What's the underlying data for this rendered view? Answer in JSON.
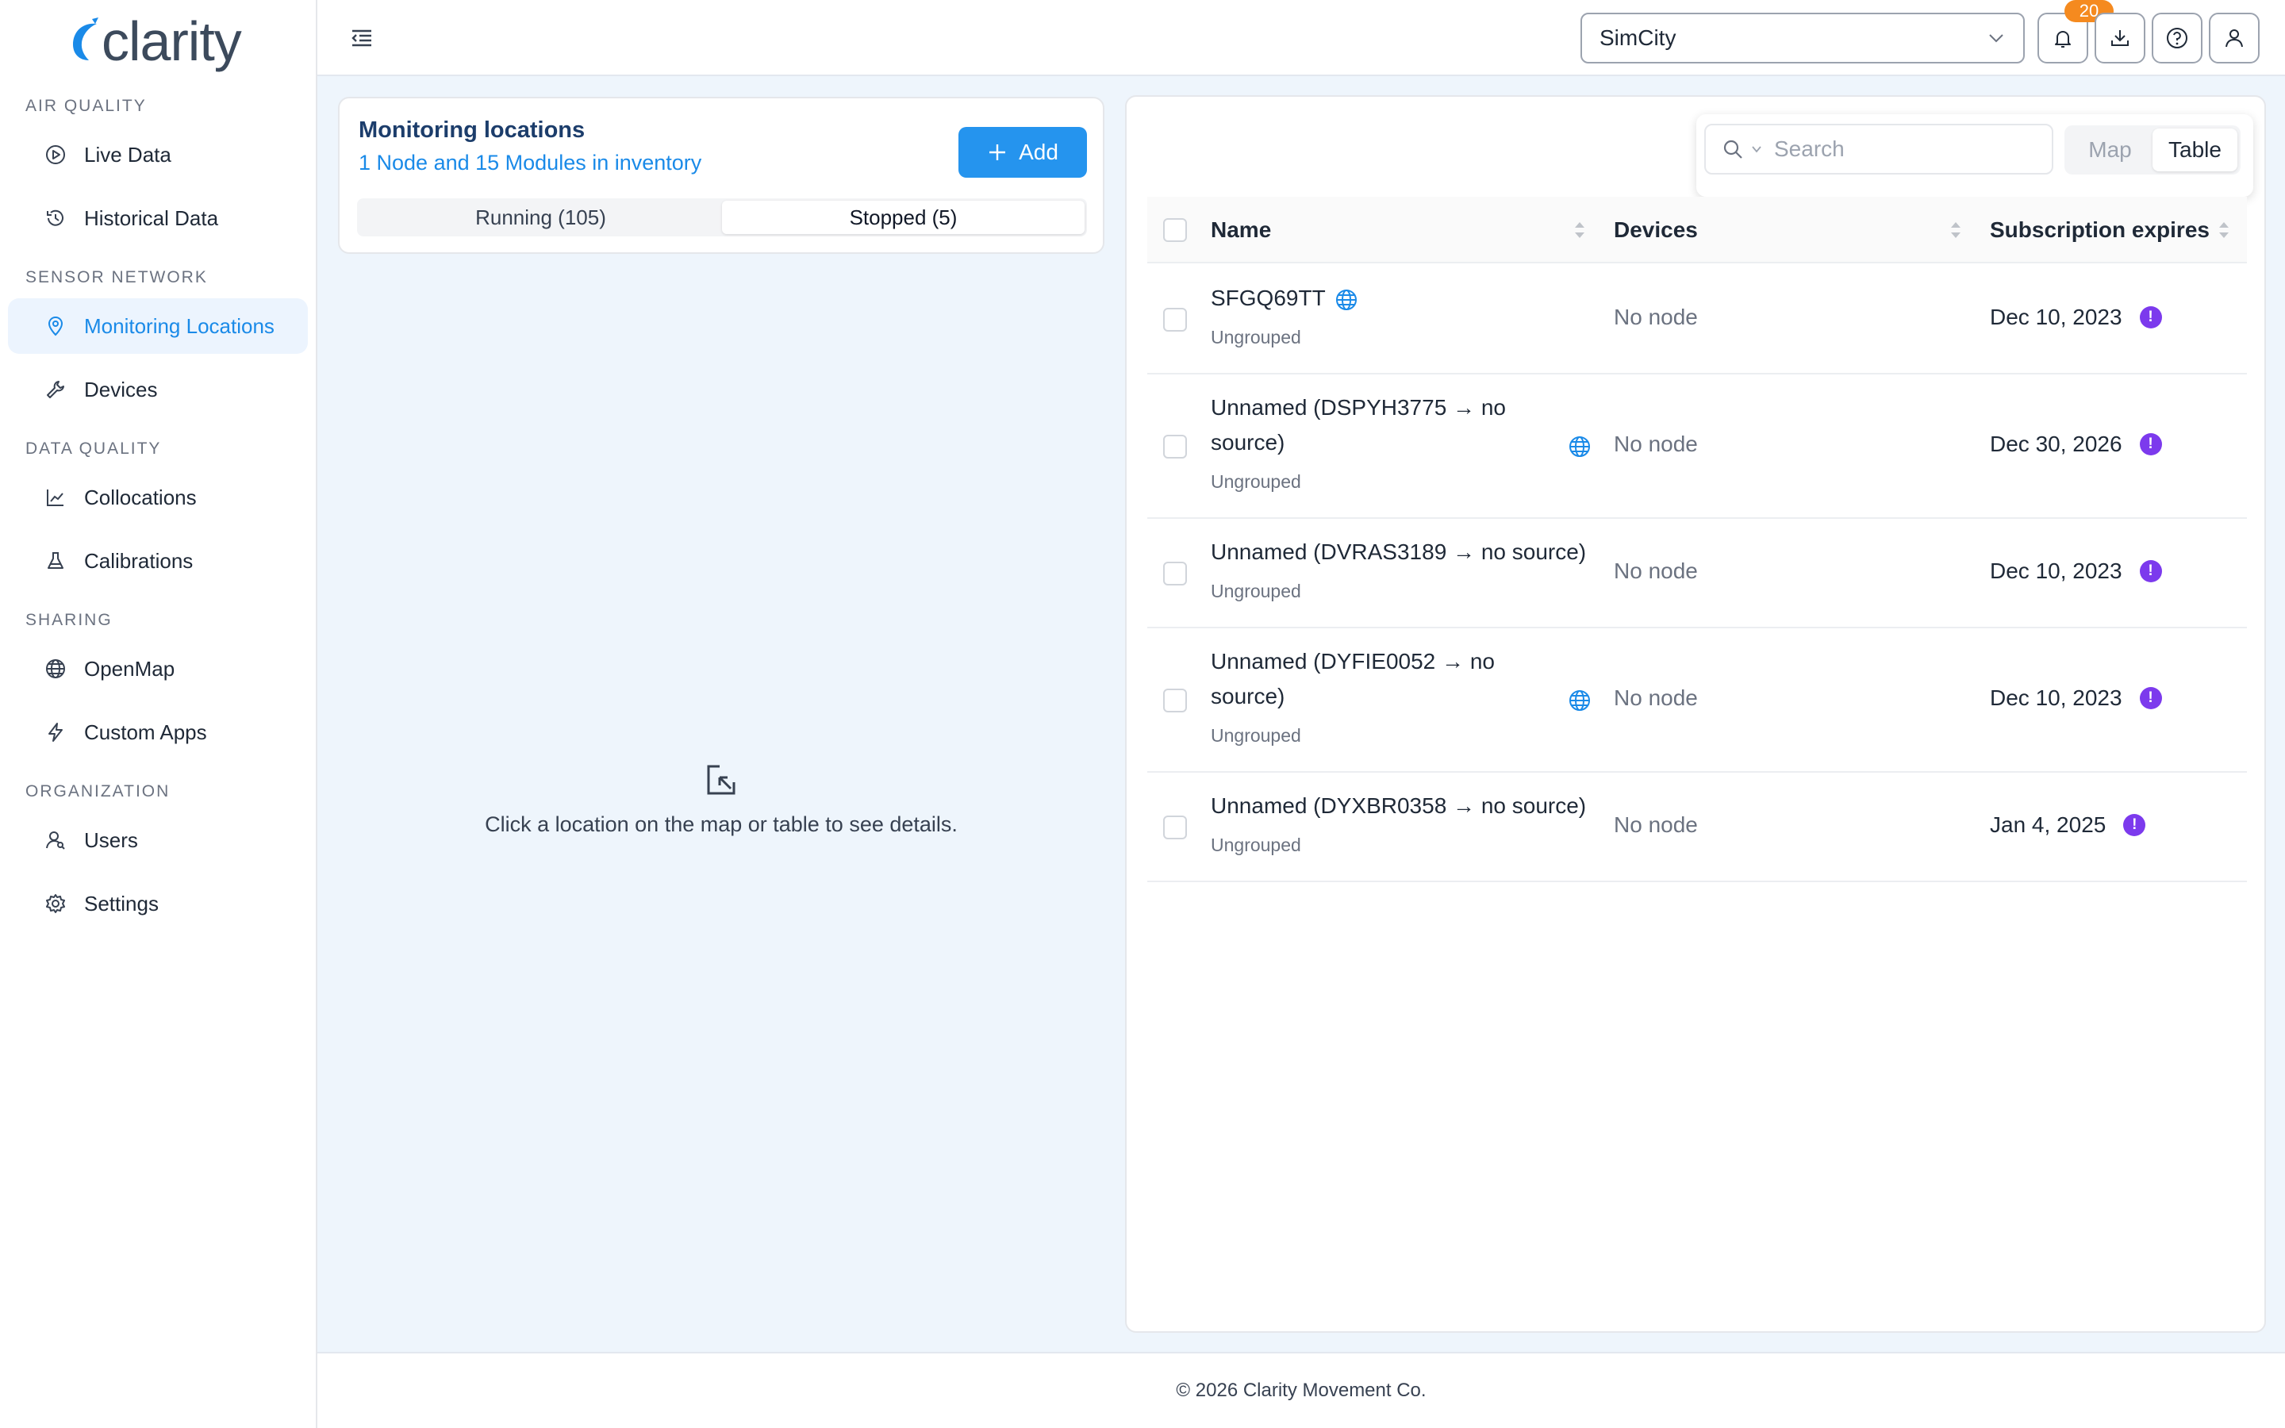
{
  "app": {
    "logo_text": "clarity"
  },
  "sidebar": {
    "sections": [
      {
        "title": "AIR QUALITY",
        "items": [
          {
            "label": "Live Data"
          },
          {
            "label": "Historical Data"
          }
        ]
      },
      {
        "title": "SENSOR NETWORK",
        "items": [
          {
            "label": "Monitoring Locations",
            "active": true
          },
          {
            "label": "Devices"
          }
        ]
      },
      {
        "title": "DATA QUALITY",
        "items": [
          {
            "label": "Collocations"
          },
          {
            "label": "Calibrations"
          }
        ]
      },
      {
        "title": "SHARING",
        "items": [
          {
            "label": "OpenMap"
          },
          {
            "label": "Custom Apps"
          }
        ]
      },
      {
        "title": "ORGANIZATION",
        "items": [
          {
            "label": "Users"
          },
          {
            "label": "Settings"
          }
        ]
      }
    ]
  },
  "topbar": {
    "org_selected": "SimCity",
    "notification_count": "20"
  },
  "locations_panel": {
    "title": "Monitoring locations",
    "inventory_link": "1 Node and 15 Modules in inventory",
    "add_label": "Add",
    "tabs": [
      {
        "label": "Running (105)"
      },
      {
        "label": "Stopped (5)",
        "selected": true
      }
    ],
    "empty_message": "Click a location on the map or table to see details."
  },
  "table": {
    "search_placeholder": "Search",
    "view_options": [
      {
        "label": "Map"
      },
      {
        "label": "Table",
        "selected": true
      }
    ],
    "columns": [
      "Name",
      "Devices",
      "Subscription expires"
    ],
    "rows": [
      {
        "name_line1": "SFGQ69TT",
        "name_line2": "",
        "group": "Ungrouped",
        "devices": "No node",
        "expires": "Dec 10, 2023",
        "globe": true
      },
      {
        "name_line1": "Unnamed (DSPYH3775 → no",
        "name_line2": "source)",
        "group": "Ungrouped",
        "devices": "No node",
        "expires": "Dec 30, 2026",
        "globe": true
      },
      {
        "name_line1": "Unnamed (DVRAS3189 → no source)",
        "name_line2": "",
        "group": "Ungrouped",
        "devices": "No node",
        "expires": "Dec 10, 2023",
        "globe": false
      },
      {
        "name_line1": "Unnamed (DYFIE0052 → no",
        "name_line2": "source)",
        "group": "Ungrouped",
        "devices": "No node",
        "expires": "Dec 10, 2023",
        "globe": true
      },
      {
        "name_line1": "Unnamed (DYXBR0358 → no source)",
        "name_line2": "",
        "group": "Ungrouped",
        "devices": "No node",
        "expires": "Jan 4, 2025",
        "globe": false
      }
    ],
    "warning_glyph": "!"
  },
  "footer": {
    "copyright": "© 2026 Clarity Movement Co."
  },
  "colors": {
    "accent": "#1a8ae8",
    "button": "#2594ee",
    "badge": "#f58a1f",
    "warning": "#7c3aed",
    "title": "#1c3d6b"
  }
}
